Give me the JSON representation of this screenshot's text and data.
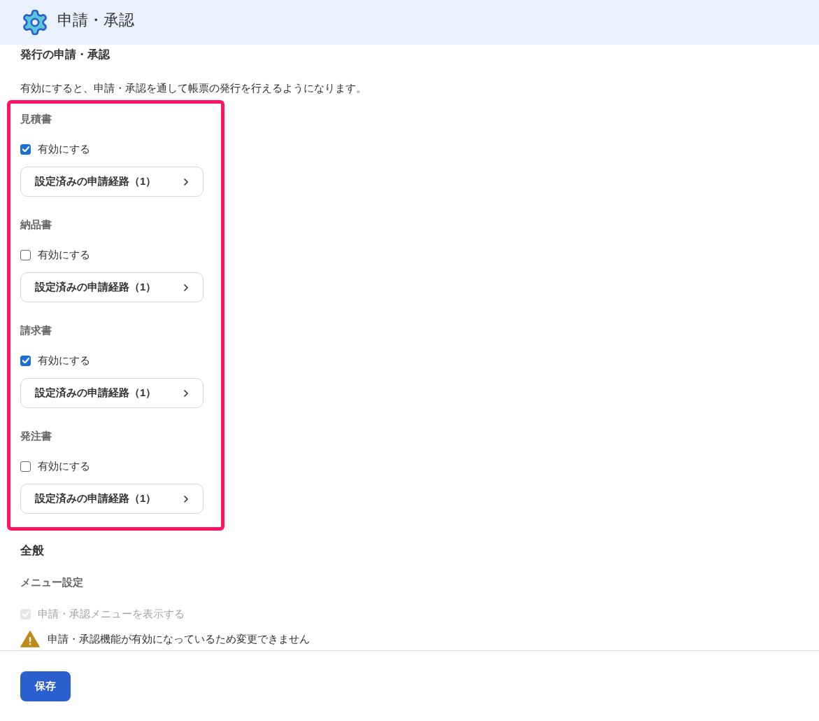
{
  "header": {
    "title": "申請・承認"
  },
  "issuance": {
    "heading": "発行の申請・承認",
    "description": "有効にすると、申請・承認を通して帳票の発行を行えるようになります。",
    "highlighted": true,
    "documents": [
      {
        "name": "見積書",
        "enable_label": "有効にする",
        "checked": true,
        "route_button": "設定済みの申請経路（1）"
      },
      {
        "name": "納品書",
        "enable_label": "有効にする",
        "checked": false,
        "route_button": "設定済みの申請経路（1）"
      },
      {
        "name": "請求書",
        "enable_label": "有効にする",
        "checked": true,
        "route_button": "設定済みの申請経路（1）"
      },
      {
        "name": "発注書",
        "enable_label": "有効にする",
        "checked": false,
        "route_button": "設定済みの申請経路（1）"
      }
    ]
  },
  "general": {
    "heading": "全般",
    "menu_settings": {
      "heading": "メニュー設定",
      "checkbox": {
        "label": "申請・承認メニューを表示する",
        "checked": true,
        "disabled": true
      },
      "warning": "申請・承認機能が有効になっているため変更できません"
    }
  },
  "footer": {
    "save_button": "保存"
  }
}
